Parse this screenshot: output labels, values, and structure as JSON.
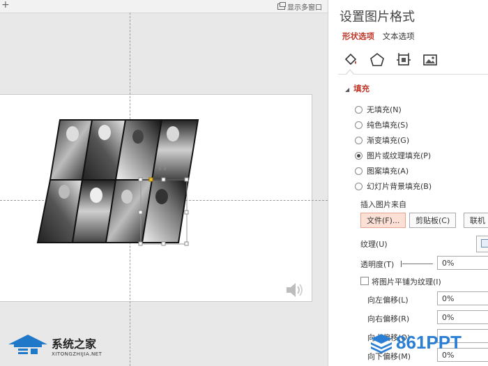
{
  "canvas": {
    "add_tab": "+",
    "multiwindow_label": "显示多窗口"
  },
  "panel": {
    "title": "设置图片格式",
    "tabs": [
      {
        "label": "形状选项",
        "active": true
      },
      {
        "label": "文本选项",
        "active": false
      }
    ],
    "icon_tabs": [
      "fill-line-icon",
      "effects-icon",
      "size-properties-icon",
      "picture-icon"
    ],
    "section_title": "填充",
    "fill_options": [
      {
        "label": "无填充(N)",
        "selected": false
      },
      {
        "label": "纯色填充(S)",
        "selected": false
      },
      {
        "label": "渐变填充(G)",
        "selected": false
      },
      {
        "label": "图片或纹理填充(P)",
        "selected": true
      },
      {
        "label": "图案填充(A)",
        "selected": false
      },
      {
        "label": "幻灯片背景填充(B)",
        "selected": false
      }
    ],
    "insert_from_label": "插入图片来自",
    "buttons": {
      "file": "文件(F)...",
      "clipboard": "剪贴板(C)",
      "online": "联机"
    },
    "texture_label": "纹理(U)",
    "transparency_label": "透明度(T)",
    "transparency_value": "0%",
    "tile_label": "将图片平铺为纹理(I)",
    "offsets": [
      {
        "label": "向左偏移(L)",
        "value": "0%"
      },
      {
        "label": "向右偏移(R)",
        "value": "0%"
      },
      {
        "label": "向上偏移(O)",
        "value": ""
      },
      {
        "label": "向下偏移(M)",
        "value": "0%"
      }
    ]
  },
  "watermarks": {
    "left_main": "系统之家",
    "left_sub": "XITONGZHIJIA.NET",
    "right": "861PPT"
  },
  "colors": {
    "accent": "#c0392b",
    "file_button_bg": "#fce0d6"
  }
}
